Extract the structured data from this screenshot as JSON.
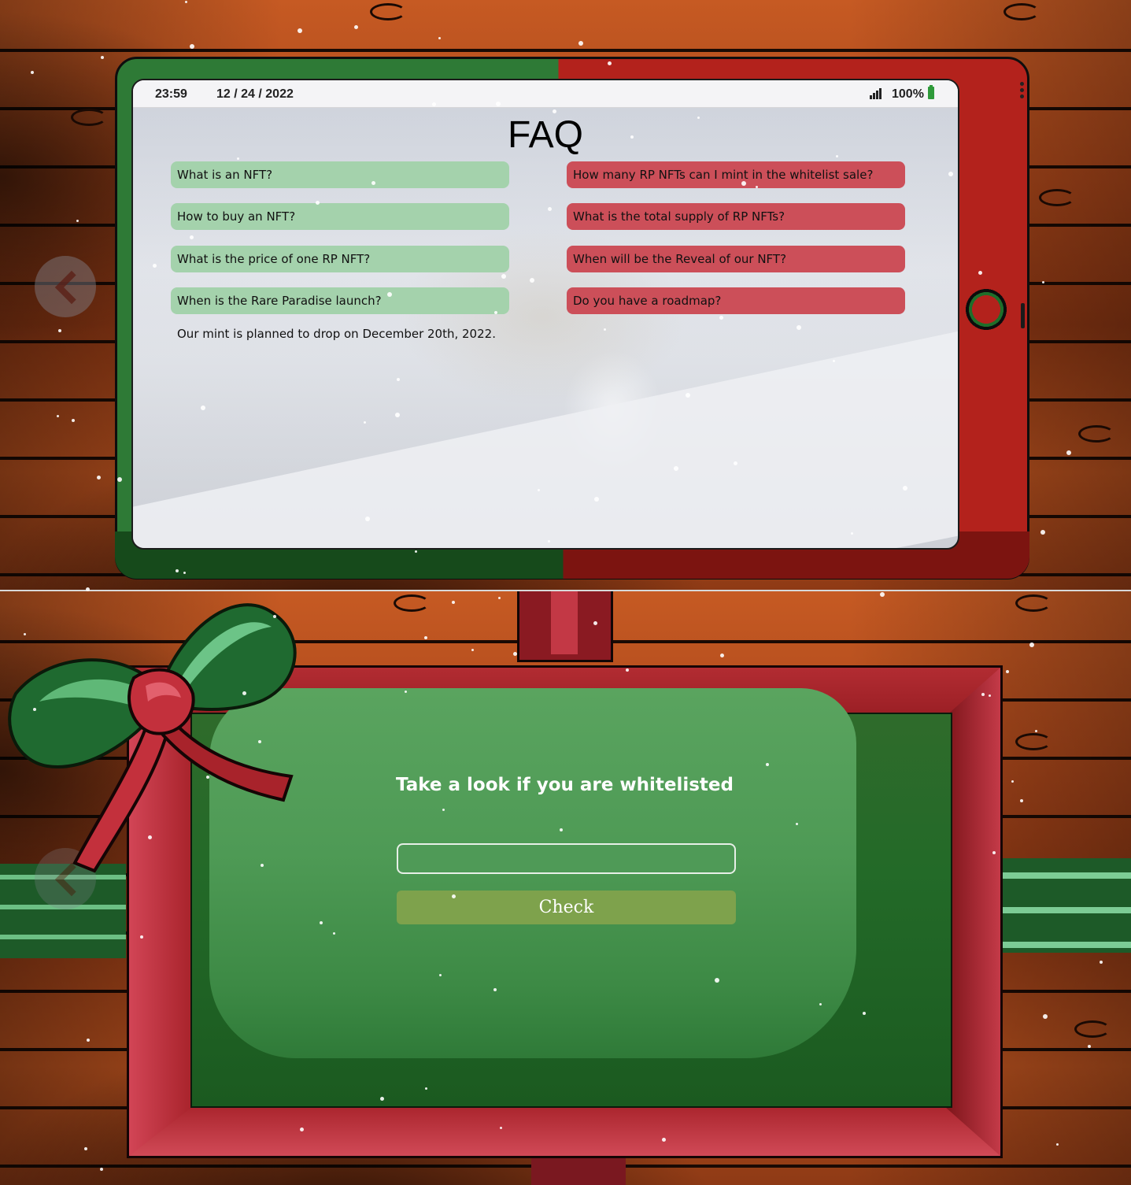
{
  "status_bar": {
    "time": "23:59",
    "date": "12 / 24 / 2022",
    "battery": "100%",
    "signal_icon": "signal-bars-icon",
    "battery_icon": "battery-icon"
  },
  "faq": {
    "title": "FAQ",
    "left_questions": [
      "What is an NFT?",
      "How to buy an NFT?",
      "What is the price of one RP NFT?",
      "When is the Rare Paradise launch?"
    ],
    "right_questions": [
      "How many RP NFTs can I mint in the whitelist sale?",
      "What is the total supply of RP NFTs?",
      "When will be the Reveal of our NFT?",
      "Do you have a roadmap?"
    ],
    "expanded_answer": "Our mint is planned to drop on December 20th, 2022."
  },
  "whitelist": {
    "title": "Take a look if you are whitelisted",
    "input_value": "",
    "button_label": "Check"
  },
  "navigation": {
    "prev_icon": "chevron-left-icon"
  },
  "colors": {
    "faq_green": "#a4d2ac",
    "faq_red": "#cc4f59",
    "check_button": "#7ea24c",
    "phone_green": "#2e7a36",
    "phone_red": "#b3221c"
  }
}
